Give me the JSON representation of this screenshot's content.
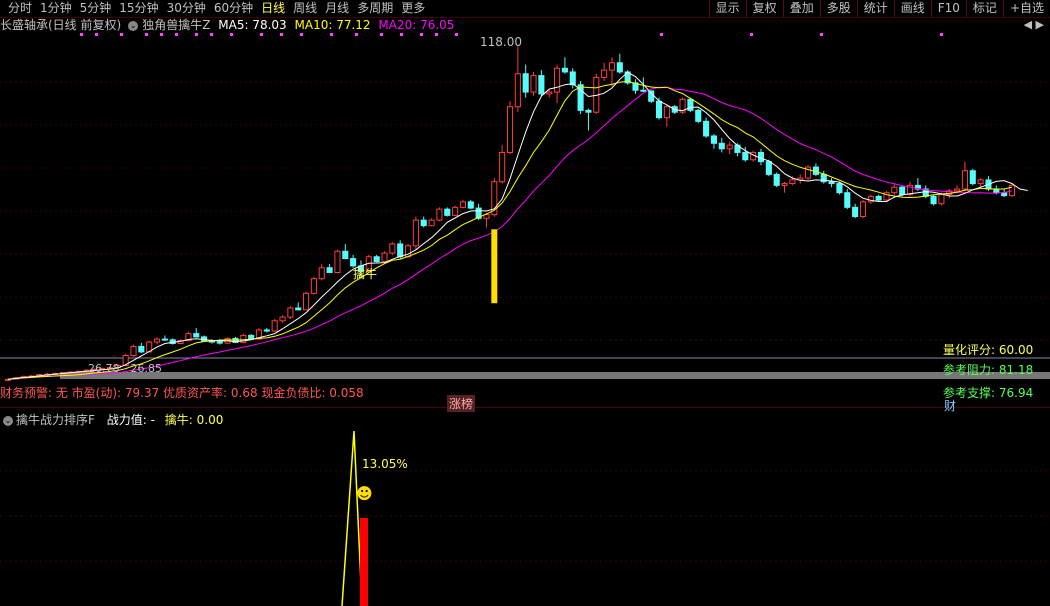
{
  "toolbar": {
    "tabs": [
      {
        "label": "分时",
        "active": false
      },
      {
        "label": "1分钟",
        "active": false
      },
      {
        "label": "5分钟",
        "active": false
      },
      {
        "label": "15分钟",
        "active": false
      },
      {
        "label": "30分钟",
        "active": false
      },
      {
        "label": "60分钟",
        "active": false
      },
      {
        "label": "日线",
        "active": true
      },
      {
        "label": "周线",
        "active": false
      },
      {
        "label": "月线",
        "active": false
      },
      {
        "label": "多周期",
        "active": false
      },
      {
        "label": "更多",
        "active": false
      }
    ],
    "tools": [
      "显示",
      "复权",
      "叠加",
      "多股",
      "统计",
      "画线",
      "F10",
      "标记",
      "+自选"
    ]
  },
  "info": {
    "stock": "长盛轴承(日线 前复权)",
    "indicator": "独角兽擒牛Z",
    "ma5": "MA5: 78.03",
    "ma10": "MA10: 77.12",
    "ma20": "MA20: 76.05",
    "nav": "◀ ▶"
  },
  "labels": {
    "high": "118.00",
    "signal": "擒牛",
    "quant": "量化评分: 60.00",
    "resist": "参考阻力: 81.18",
    "support": "参考支撑: 76.94",
    "fin_badge": "财",
    "low_range": "26.78 - 26.85",
    "finance": "财务预警: 无 市盈(动): 79.37 优质资产率: 0.68 现金负债比: 0.058",
    "limit_badge": "涨榜"
  },
  "sub": {
    "title": "擒牛战力排序F",
    "power": "战力值: -",
    "qn": "擒牛: 0.00",
    "pct": "13.05%",
    "smile": "☻"
  },
  "colors": {
    "up": "#ff3c3c",
    "down": "#54fcfc",
    "ma5": "#ffffff",
    "ma10": "#ffff00",
    "ma20": "#ff00ff",
    "text_yellow": "#ffff55",
    "text_green": "#55ff55",
    "text_red": "#ff5555"
  },
  "chart_data": {
    "type": "candlestick",
    "ylim": [
      26,
      120
    ],
    "candles": [
      [
        26.8,
        27.2,
        26.5,
        27.0
      ],
      [
        27.1,
        27.6,
        26.9,
        27.4
      ],
      [
        27.4,
        28.0,
        27.2,
        27.8
      ],
      [
        27.8,
        28.2,
        27.5,
        27.9
      ],
      [
        27.9,
        28.5,
        27.6,
        28.3
      ],
      [
        28.3,
        28.8,
        28.0,
        28.4
      ],
      [
        28.4,
        28.9,
        28.2,
        28.6
      ],
      [
        28.6,
        29.0,
        28.3,
        28.8
      ],
      [
        28.8,
        29.2,
        28.5,
        29.0
      ],
      [
        29.0,
        29.4,
        28.7,
        29.2
      ],
      [
        29.2,
        29.8,
        29.0,
        29.5
      ],
      [
        29.5,
        30.0,
        29.2,
        29.7
      ],
      [
        29.7,
        30.2,
        29.4,
        30.0
      ],
      [
        30.0,
        30.5,
        29.8,
        30.2
      ],
      [
        30.2,
        31.0,
        30.0,
        30.8
      ],
      [
        30.8,
        34.0,
        30.5,
        33.5
      ],
      [
        33.5,
        36.5,
        33.2,
        36.0
      ],
      [
        36.0,
        37.0,
        34.2,
        34.5
      ],
      [
        34.5,
        37.5,
        34.3,
        37.2
      ],
      [
        37.2,
        38.5,
        36.5,
        38.0
      ],
      [
        38.0,
        39.0,
        37.5,
        37.8
      ],
      [
        37.8,
        38.2,
        36.5,
        36.8
      ],
      [
        36.8,
        38.0,
        36.6,
        37.6
      ],
      [
        37.6,
        40.0,
        37.4,
        39.5
      ],
      [
        39.5,
        41.0,
        38.4,
        38.6
      ],
      [
        38.6,
        39.0,
        37.2,
        37.5
      ],
      [
        37.5,
        38.0,
        36.8,
        37.2
      ],
      [
        37.2,
        38.0,
        36.5,
        36.9
      ],
      [
        36.9,
        38.5,
        36.7,
        38.2
      ],
      [
        38.2,
        38.6,
        36.9,
        37.1
      ],
      [
        37.1,
        39.5,
        36.9,
        39.0
      ],
      [
        39.0,
        39.4,
        37.8,
        38.0
      ],
      [
        38.0,
        41.0,
        37.8,
        40.5
      ],
      [
        40.5,
        41.0,
        39.8,
        40.2
      ],
      [
        40.2,
        43.5,
        40.0,
        43.0
      ],
      [
        43.0,
        44.5,
        42.5,
        44.0
      ],
      [
        44.0,
        47.0,
        43.5,
        46.5
      ],
      [
        46.5,
        48.0,
        45.8,
        46.0
      ],
      [
        46.0,
        51.0,
        45.8,
        50.5
      ],
      [
        50.5,
        55.0,
        50.2,
        54.5
      ],
      [
        54.5,
        58.5,
        54.0,
        57.5
      ],
      [
        57.5,
        58.5,
        56.0,
        56.2
      ],
      [
        56.2,
        62.5,
        56.0,
        62.0
      ],
      [
        62.0,
        64.0,
        59.8,
        60.0
      ],
      [
        60.0,
        61.0,
        57.5,
        58.0
      ],
      [
        58.0,
        59.5,
        55.0,
        56.5
      ],
      [
        56.5,
        61.0,
        56.3,
        60.5
      ],
      [
        60.5,
        61.0,
        59.0,
        59.2
      ],
      [
        59.2,
        62.0,
        59.0,
        61.5
      ],
      [
        61.5,
        64.5,
        61.0,
        64.0
      ],
      [
        64.0,
        65.0,
        60.0,
        60.5
      ],
      [
        60.5,
        64.0,
        60.3,
        63.5
      ],
      [
        63.5,
        71.5,
        62.5,
        70.5
      ],
      [
        70.5,
        71.5,
        68.5,
        69.0
      ],
      [
        69.0,
        71.0,
        68.8,
        70.5
      ],
      [
        70.5,
        74.0,
        70.2,
        73.5
      ],
      [
        73.5,
        74.0,
        71.5,
        71.8
      ],
      [
        71.8,
        74.5,
        71.6,
        74.0
      ],
      [
        74.0,
        76.0,
        73.8,
        75.5
      ],
      [
        75.5,
        76.0,
        73.5,
        73.8
      ],
      [
        73.8,
        75.0,
        70.5,
        71.0
      ],
      [
        71.0,
        72.5,
        68.5,
        72.0
      ],
      [
        72.0,
        82.0,
        71.5,
        81.0
      ],
      [
        81.0,
        91.0,
        80.5,
        89.0
      ],
      [
        89.0,
        103.0,
        88.5,
        101.5
      ],
      [
        101.5,
        118.0,
        100.0,
        110.5
      ],
      [
        110.5,
        113.0,
        104.0,
        105.5
      ],
      [
        105.5,
        111.0,
        104.5,
        110.0
      ],
      [
        110.0,
        111.5,
        104.5,
        105.0
      ],
      [
        105.0,
        106.0,
        104.0,
        105.5
      ],
      [
        105.5,
        113.0,
        102.5,
        112.0
      ],
      [
        112.0,
        115.0,
        110.5,
        111.0
      ],
      [
        111.0,
        112.0,
        106.5,
        107.5
      ],
      [
        107.5,
        108.5,
        99.5,
        100.5
      ],
      [
        100.5,
        101.0,
        95.0,
        100.0
      ],
      [
        100.0,
        110.5,
        99.5,
        109.5
      ],
      [
        109.5,
        113.5,
        108.5,
        111.5
      ],
      [
        111.5,
        115.0,
        107.0,
        113.5
      ],
      [
        113.5,
        116.0,
        110.5,
        111.0
      ],
      [
        111.0,
        111.5,
        107.5,
        108.0
      ],
      [
        108.0,
        109.0,
        105.0,
        106.0
      ],
      [
        106.0,
        109.5,
        105.5,
        105.8
      ],
      [
        105.8,
        106.0,
        102.5,
        103.0
      ],
      [
        103.0,
        104.0,
        98.0,
        98.5
      ],
      [
        98.5,
        102.0,
        96.0,
        101.5
      ],
      [
        101.5,
        102.0,
        99.5,
        100.0
      ],
      [
        100.0,
        104.0,
        99.5,
        103.5
      ],
      [
        103.5,
        104.0,
        100.0,
        100.5
      ],
      [
        100.5,
        101.0,
        97.0,
        97.5
      ],
      [
        97.5,
        98.5,
        93.0,
        93.5
      ],
      [
        93.5,
        94.0,
        90.0,
        91.5
      ],
      [
        91.5,
        93.0,
        89.0,
        90.0
      ],
      [
        90.0,
        92.0,
        88.5,
        91.0
      ],
      [
        91.0,
        91.5,
        88.0,
        89.0
      ],
      [
        89.0,
        90.5,
        86.5,
        87.0
      ],
      [
        87.0,
        89.5,
        86.5,
        89.0
      ],
      [
        89.0,
        90.0,
        85.5,
        86.5
      ],
      [
        86.5,
        87.0,
        82.5,
        83.0
      ],
      [
        83.0,
        83.5,
        79.5,
        80.0
      ],
      [
        80.0,
        81.0,
        78.0,
        80.5
      ],
      [
        80.5,
        82.5,
        80.0,
        81.5
      ],
      [
        81.5,
        83.0,
        80.5,
        82.0
      ],
      [
        82.0,
        85.5,
        81.5,
        85.0
      ],
      [
        85.0,
        86.0,
        82.5,
        83.0
      ],
      [
        83.0,
        84.0,
        80.5,
        81.0
      ],
      [
        81.0,
        82.0,
        79.5,
        80.5
      ],
      [
        80.5,
        81.0,
        77.5,
        78.0
      ],
      [
        78.0,
        79.0,
        73.5,
        74.0
      ],
      [
        74.0,
        75.0,
        71.0,
        71.5
      ],
      [
        71.5,
        76.0,
        71.0,
        75.5
      ],
      [
        75.5,
        77.5,
        75.0,
        77.0
      ],
      [
        77.0,
        77.5,
        75.5,
        76.0
      ],
      [
        76.0,
        78.5,
        75.5,
        78.0
      ],
      [
        78.0,
        80.5,
        77.5,
        79.5
      ],
      [
        79.5,
        80.0,
        77.0,
        77.5
      ],
      [
        77.5,
        81.0,
        77.0,
        80.0
      ],
      [
        80.0,
        82.0,
        78.5,
        79.0
      ],
      [
        79.0,
        80.0,
        76.5,
        77.0
      ],
      [
        77.0,
        77.5,
        74.5,
        75.0
      ],
      [
        75.0,
        78.0,
        74.5,
        77.5
      ],
      [
        77.5,
        79.0,
        76.5,
        78.5
      ],
      [
        78.5,
        80.0,
        78.0,
        79.0
      ],
      [
        79.0,
        86.5,
        78.5,
        84.0
      ],
      [
        84.0,
        84.5,
        80.0,
        80.5
      ],
      [
        80.5,
        82.0,
        79.5,
        81.5
      ],
      [
        81.5,
        82.5,
        78.5,
        79.0
      ],
      [
        79.0,
        80.0,
        77.5,
        78.0
      ],
      [
        78.0,
        79.0,
        76.8,
        77.2
      ],
      [
        77.2,
        80.5,
        76.9,
        80.0
      ]
    ],
    "ma5": [
      27.0,
      27.3,
      27.5,
      27.7,
      28.0,
      28.2,
      28.4,
      28.6,
      28.8,
      29.0,
      29.2,
      29.4,
      29.6,
      29.8,
      30.1,
      31.0,
      32.2,
      33.4,
      34.6,
      35.8,
      36.8,
      37.1,
      37.4,
      37.9,
      38.1,
      37.9,
      37.6,
      37.5,
      37.5,
      37.3,
      37.5,
      37.8,
      38.4,
      38.9,
      39.5,
      40.8,
      42.2,
      43.6,
      45.2,
      47.3,
      49.5,
      51.5,
      53.6,
      55.5,
      57.1,
      58.0,
      58.7,
      58.8,
      58.9,
      59.8,
      60.6,
      61.2,
      62.4,
      64.1,
      65.7,
      67.7,
      69.9,
      71.1,
      72.3,
      73.0,
      73.1,
      73.0,
      73.6,
      76.3,
      81.8,
      88.2,
      94.6,
      100.1,
      104.4,
      106.3,
      106.8,
      107.5,
      107.8,
      106.1,
      104.3,
      104.6,
      105.2,
      106.6,
      109.0,
      110.9,
      109.7,
      107.6,
      105.2,
      103.1,
      102.0,
      100.7,
      100.4,
      101.3,
      101.4,
      99.9,
      97.9,
      95.3,
      92.8,
      90.9,
      89.5,
      88.3,
      87.4,
      86.7,
      85.2,
      83.2,
      82.0,
      81.4,
      81.2,
      81.5,
      81.4,
      81.2,
      80.9,
      79.6,
      77.9,
      76.5,
      75.9,
      75.6,
      75.6,
      76.8,
      77.4,
      77.7,
      78.0,
      78.3,
      78.1,
      77.7,
      77.1,
      77.1,
      77.8,
      78.8,
      79.5,
      80.3,
      81.1,
      81.3,
      80.5,
      79.0,
      78.6
    ]
  }
}
